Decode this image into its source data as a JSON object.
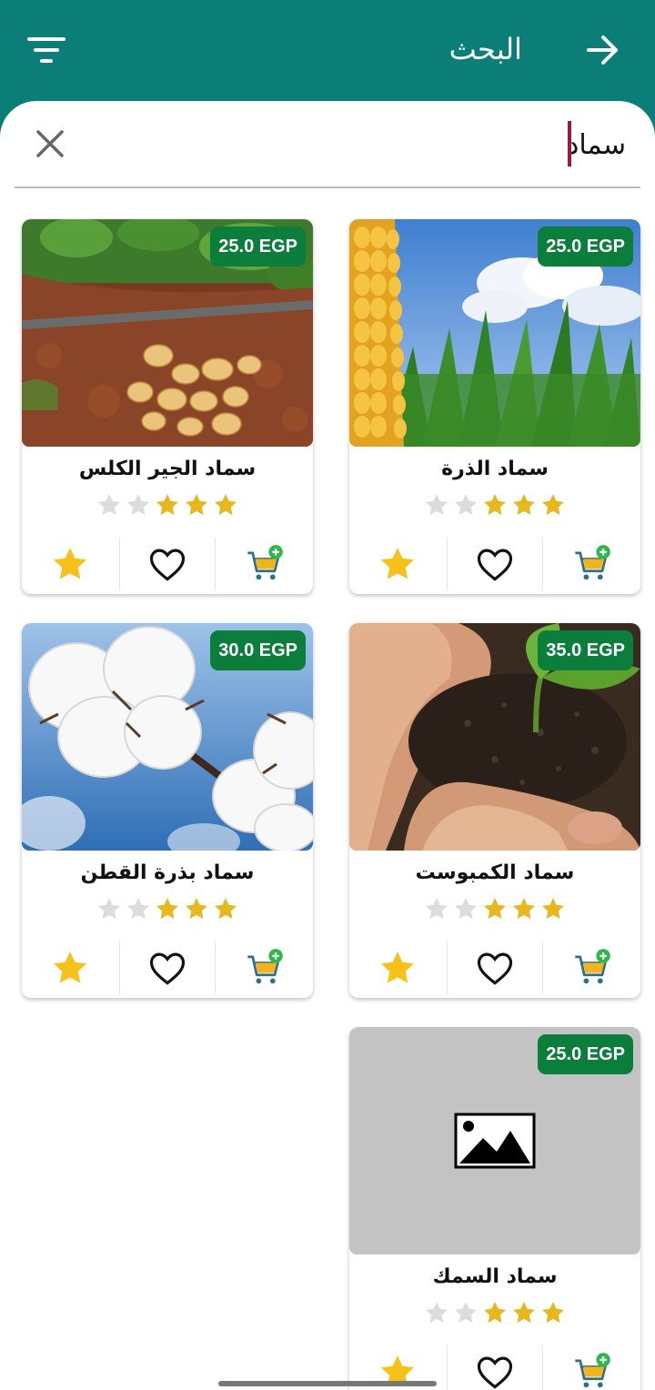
{
  "appbar": {
    "title": "البحث",
    "filter_icon": "filter-icon",
    "back_icon": "arrow-right-icon"
  },
  "search": {
    "value": "سماد",
    "clear_icon": "close-icon"
  },
  "colors": {
    "primary": "#0b7e77",
    "price_badge": "#0a7e3a",
    "star_filled": "#f5c518",
    "star_empty": "#dcdcdc",
    "cart_badge": "#2fb84a"
  },
  "products": [
    {
      "name": "سماد الذرة",
      "price": "25.0 EGP",
      "rating": 3,
      "image": "corn-field"
    },
    {
      "name": "سماد الجير الكلس",
      "price": "25.0 EGP",
      "rating": 3,
      "image": "potato-soil"
    },
    {
      "name": "سماد الكمبوست",
      "price": "35.0 EGP",
      "rating": 3,
      "image": "hands-soil-sprout"
    },
    {
      "name": "سماد بذرة القطن",
      "price": "30.0 EGP",
      "rating": 3,
      "image": "cotton-boll"
    },
    {
      "name": "سماد السمك",
      "price": "25.0 EGP",
      "rating": 3,
      "image": "placeholder-image"
    }
  ]
}
